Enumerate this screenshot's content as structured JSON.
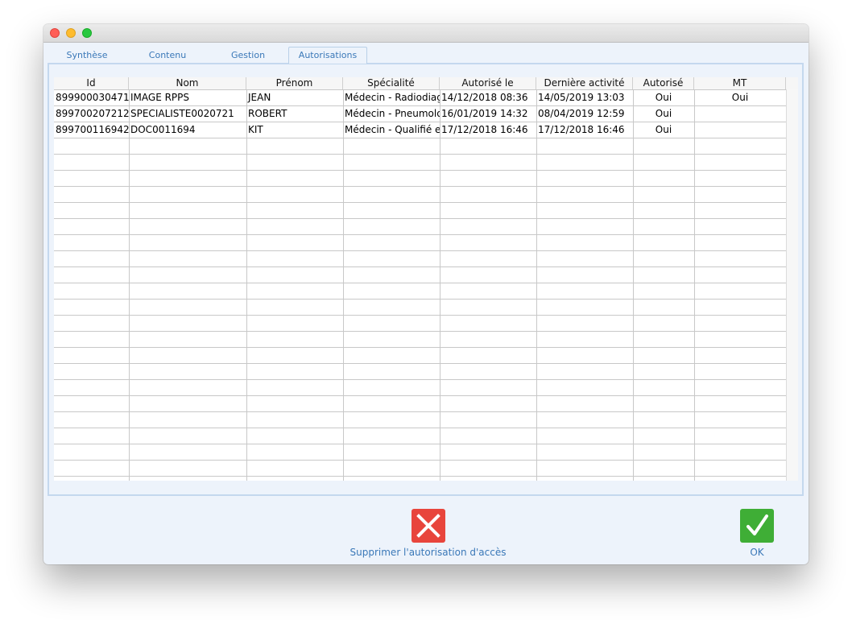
{
  "tabs": [
    {
      "label": "Synthèse"
    },
    {
      "label": "Contenu"
    },
    {
      "label": "Gestion"
    },
    {
      "label": "Autorisations"
    }
  ],
  "table": {
    "columns": [
      "Id",
      "Nom",
      "Prénom",
      "Spécialité",
      "Autorisé le",
      "Dernière activité",
      "Autorisé",
      "MT"
    ],
    "rows": [
      [
        "899900030471",
        "IMAGE RPPS",
        "JEAN",
        "Médecin - Radiodiagnostic",
        "14/12/2018 08:36",
        "14/05/2019 13:03",
        "Oui",
        "Oui"
      ],
      [
        "899700207212",
        "SPECIALISTE0020721",
        "ROBERT",
        "Médecin - Pneumologie",
        "16/01/2019 14:32",
        "08/04/2019 12:59",
        "Oui",
        ""
      ],
      [
        "899700116942",
        "DOC0011694",
        "KIT",
        "Médecin - Qualifié en",
        "17/12/2018 16:46",
        "17/12/2018 16:46",
        "Oui",
        ""
      ]
    ]
  },
  "footer": {
    "delete_label": "Supprimer l'autorisation d'accès",
    "ok_label": "OK",
    "delete_icon": "close-x-icon",
    "ok_icon": "checkmark-icon",
    "delete_color": "#e8453c",
    "ok_color": "#3fae36"
  }
}
